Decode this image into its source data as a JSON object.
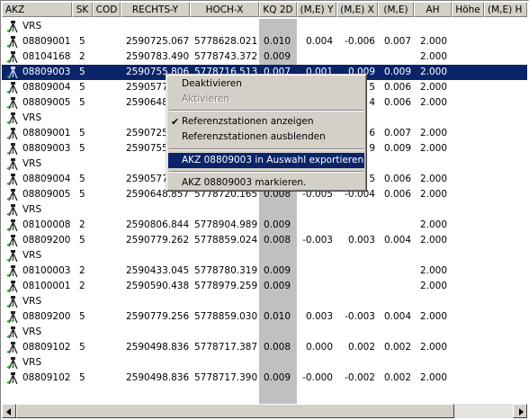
{
  "columns": {
    "akz": "AKZ",
    "sk": "SK",
    "cod": "COD",
    "rechts_y": "RECHTS-Y",
    "hoch_x": "HOCH-X",
    "kq2d": "KQ 2D",
    "me_y": "(M,E) Y",
    "me_x": "(M,E) X",
    "me": "(M,E)",
    "ah": "AH",
    "hoehe": "Höhe",
    "me_h": "(M,E) H"
  },
  "rows": [
    {
      "type": "vrs",
      "akz": "VRS",
      "sk": "",
      "cod": "",
      "ry": "",
      "hx": "",
      "kq": "",
      "mey": "",
      "mex": "",
      "me": "",
      "ah": ""
    },
    {
      "type": "pt",
      "akz": "08809001",
      "sk": "5",
      "cod": "",
      "ry": "2590725.067",
      "hx": "5778628.021",
      "kq": "0.010",
      "mey": "0.004",
      "mex": "-0.006",
      "me": "0.007",
      "ah": "2.000"
    },
    {
      "type": "pt",
      "akz": "08104168",
      "sk": "2",
      "cod": "",
      "ry": "2590783.490",
      "hx": "5778743.372",
      "kq": "0.009",
      "mey": "",
      "mex": "",
      "me": "",
      "ah": "2.000"
    },
    {
      "type": "pt",
      "akz": "08809003",
      "sk": "5",
      "cod": "",
      "ry": "2590755.806",
      "hx": "5778716.513",
      "kq": "0.007",
      "mey": "0.001",
      "mex": "0.009",
      "me": "0.009",
      "ah": "2.000",
      "selected": true
    },
    {
      "type": "pt",
      "akz": "08809004",
      "sk": "5",
      "cod": "",
      "ry": "2590577",
      "hx": "",
      "kq": "",
      "mey": "",
      "mex": "5",
      "me": "0.006",
      "ah": "2.000"
    },
    {
      "type": "pt",
      "akz": "08809005",
      "sk": "5",
      "cod": "",
      "ry": "2590648",
      "hx": "",
      "kq": "",
      "mey": "",
      "mex": "4",
      "me": "0.006",
      "ah": "2.000"
    },
    {
      "type": "vrs",
      "akz": "VRS",
      "sk": "",
      "cod": "",
      "ry": "",
      "hx": "",
      "kq": "",
      "mey": "",
      "mex": "",
      "me": "",
      "ah": ""
    },
    {
      "type": "pt",
      "akz": "08809001",
      "sk": "5",
      "cod": "",
      "ry": "2590725",
      "hx": "",
      "kq": "",
      "mey": "",
      "mex": "6",
      "me": "0.007",
      "ah": "2.000"
    },
    {
      "type": "pt",
      "akz": "08809003",
      "sk": "5",
      "cod": "",
      "ry": "2590755",
      "hx": "",
      "kq": "",
      "mey": "",
      "mex": "9",
      "me": "0.009",
      "ah": "2.000"
    },
    {
      "type": "vrs",
      "akz": "VRS",
      "sk": "",
      "cod": "",
      "ry": "",
      "hx": "",
      "kq": "",
      "mey": "",
      "mex": "",
      "me": "",
      "ah": ""
    },
    {
      "type": "pt",
      "akz": "08809004",
      "sk": "5",
      "cod": "",
      "ry": "2590577",
      "hx": "",
      "kq": "",
      "mey": "",
      "mex": "5",
      "me": "0.006",
      "ah": "2.000"
    },
    {
      "type": "pt",
      "akz": "08809005",
      "sk": "5",
      "cod": "",
      "ry": "2590648.857",
      "hx": "5778720.165",
      "kq": "0.008",
      "mey": "-0.005",
      "mex": "-0.004",
      "me": "0.006",
      "ah": "2.000"
    },
    {
      "type": "vrs",
      "akz": "VRS",
      "sk": "",
      "cod": "",
      "ry": "",
      "hx": "",
      "kq": "",
      "mey": "",
      "mex": "",
      "me": "",
      "ah": ""
    },
    {
      "type": "pt",
      "akz": "08100008",
      "sk": "2",
      "cod": "",
      "ry": "2590806.844",
      "hx": "5778904.989",
      "kq": "0.009",
      "mey": "",
      "mex": "",
      "me": "",
      "ah": "2.000"
    },
    {
      "type": "pt",
      "akz": "08809200",
      "sk": "5",
      "cod": "",
      "ry": "2590779.262",
      "hx": "5778859.024",
      "kq": "0.008",
      "mey": "-0.003",
      "mex": "0.003",
      "me": "0.004",
      "ah": "2.000"
    },
    {
      "type": "vrs",
      "akz": "VRS",
      "sk": "",
      "cod": "",
      "ry": "",
      "hx": "",
      "kq": "",
      "mey": "",
      "mex": "",
      "me": "",
      "ah": ""
    },
    {
      "type": "pt",
      "akz": "08100003",
      "sk": "2",
      "cod": "",
      "ry": "2590433.045",
      "hx": "5778780.319",
      "kq": "0.009",
      "mey": "",
      "mex": "",
      "me": "",
      "ah": "2.000"
    },
    {
      "type": "pt",
      "akz": "08100001",
      "sk": "2",
      "cod": "",
      "ry": "2590590.438",
      "hx": "5778979.259",
      "kq": "0.009",
      "mey": "",
      "mex": "",
      "me": "",
      "ah": "2.000"
    },
    {
      "type": "vrs",
      "akz": "VRS",
      "sk": "",
      "cod": "",
      "ry": "",
      "hx": "",
      "kq": "",
      "mey": "",
      "mex": "",
      "me": "",
      "ah": ""
    },
    {
      "type": "pt",
      "akz": "08809200",
      "sk": "5",
      "cod": "",
      "ry": "2590779.256",
      "hx": "5778859.030",
      "kq": "0.010",
      "mey": "0.003",
      "mex": "-0.003",
      "me": "0.004",
      "ah": "2.000"
    },
    {
      "type": "vrs",
      "akz": "VRS",
      "sk": "",
      "cod": "",
      "ry": "",
      "hx": "",
      "kq": "",
      "mey": "",
      "mex": "",
      "me": "",
      "ah": ""
    },
    {
      "type": "pt",
      "akz": "08809102",
      "sk": "5",
      "cod": "",
      "ry": "2590498.836",
      "hx": "5778717.387",
      "kq": "0.008",
      "mey": "0.000",
      "mex": "0.002",
      "me": "0.002",
      "ah": "2.000"
    },
    {
      "type": "vrs",
      "akz": "VRS",
      "sk": "",
      "cod": "",
      "ry": "",
      "hx": "",
      "kq": "",
      "mey": "",
      "mex": "",
      "me": "",
      "ah": ""
    },
    {
      "type": "pt",
      "akz": "08809102",
      "sk": "5",
      "cod": "",
      "ry": "2590498.836",
      "hx": "5778717.390",
      "kq": "0.009",
      "mey": "-0.000",
      "mex": "-0.002",
      "me": "0.002",
      "ah": "2.000"
    }
  ],
  "context_menu": {
    "deaktivieren": "Deaktivieren",
    "aktivieren": "Aktivieren",
    "anzeigen": "Referenzstationen anzeigen",
    "ausblenden": "Referenzstationen ausblenden",
    "exportieren": "AKZ 08809003 in Auswahl exportieren",
    "markieren": "AKZ 08809003 markieren."
  },
  "icons": {
    "station": "surveyor-tripod-icon",
    "check": "checkmark-icon"
  },
  "colors": {
    "selection": "#0a246a",
    "kq_band": "#c0c0c0",
    "face": "#d4d0c8"
  }
}
